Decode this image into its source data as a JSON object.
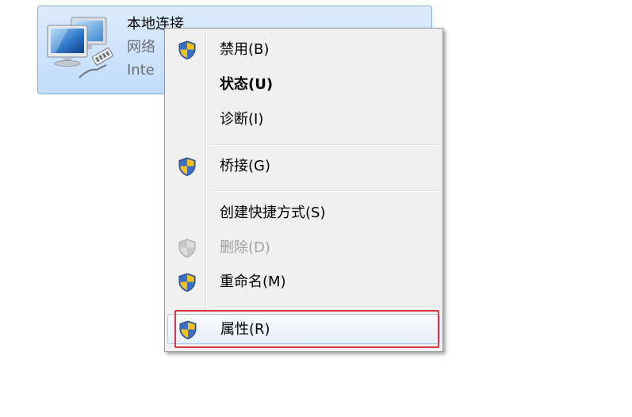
{
  "adapter": {
    "name": "本地连接",
    "network_text": "网络",
    "device_text": "Inte",
    "icon": "network-adapter-icon"
  },
  "menu": {
    "items": [
      {
        "label": "禁用(B)",
        "icon": "uac-shield-icon"
      },
      {
        "label": "状态(U)"
      },
      {
        "label": "诊断(I)"
      },
      {
        "label": "桥接(G)",
        "icon": "uac-shield-icon"
      },
      {
        "label": "创建快捷方式(S)"
      },
      {
        "label": "删除(D)",
        "icon": "uac-shield-icon",
        "state": "disabled"
      },
      {
        "label": "重命名(M)",
        "icon": "uac-shield-icon"
      },
      {
        "label": "属性(R)",
        "icon": "uac-shield-icon",
        "state": "highlighted"
      }
    ]
  },
  "colors": {
    "selection_fill": "#c9e0fb",
    "selection_border": "#84acdd",
    "menu_background": "#f0f0f0",
    "callout_border": "#d9363e",
    "disabled_text": "#a0a0a0"
  }
}
